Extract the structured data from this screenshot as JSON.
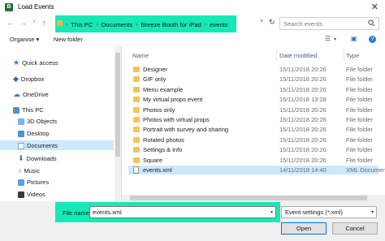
{
  "window": {
    "title": "Load Events",
    "app_icon_letter": "B"
  },
  "nav": {
    "back": "←",
    "forward": "→",
    "up": "↑",
    "dropdown": "˅",
    "refresh": "↻"
  },
  "address": {
    "crumbs": [
      "This PC",
      "Documents",
      "Breeze Booth for iPad",
      "events"
    ],
    "separator": "›",
    "leading_separator": "›"
  },
  "search": {
    "placeholder": "Search events",
    "icon": "search-icon"
  },
  "toolbar": {
    "organise": "Organise ▾",
    "new_folder": "New folder",
    "view_icon": "view-options-icon",
    "view_chev": "▾",
    "pane_icon": "preview-pane-icon",
    "help_icon": "help-icon"
  },
  "sidebar": {
    "items": [
      {
        "label": "Quick access",
        "icon": "star-icon",
        "color": "#2f7dd1"
      },
      {
        "label": "Dropbox",
        "icon": "dropbox-icon",
        "color": "#2468c8"
      },
      {
        "label": "OneDrive",
        "icon": "cloud-icon",
        "color": "#2f7dd1"
      },
      {
        "label": "This PC",
        "icon": "computer-icon",
        "color": "#5a8fc7"
      },
      {
        "label": "3D Objects",
        "icon": "cube-icon",
        "color": "#7fb2e5"
      },
      {
        "label": "Desktop",
        "icon": "desktop-icon",
        "color": "#4a90d9"
      },
      {
        "label": "Documents",
        "icon": "documents-icon",
        "color": "#c7ddf2"
      },
      {
        "label": "Downloads",
        "icon": "download-icon",
        "color": "#2f7dd1"
      },
      {
        "label": "Music",
        "icon": "music-icon",
        "color": "#3a87d4"
      },
      {
        "label": "Pictures",
        "icon": "pictures-icon",
        "color": "#5aa0dc"
      },
      {
        "label": "Videos",
        "icon": "video-icon",
        "color": "#3b3b3b"
      }
    ],
    "selected": "Documents"
  },
  "columns": {
    "name": "Name",
    "date": "Date modified",
    "type": "Type"
  },
  "files": [
    {
      "name": "Designer",
      "date": "15/11/2018 20:26",
      "type": "File folder",
      "kind": "folder"
    },
    {
      "name": "GIF only",
      "date": "15/11/2018 20:26",
      "type": "File folder",
      "kind": "folder"
    },
    {
      "name": "Menu example",
      "date": "15/11/2018 20:26",
      "type": "File folder",
      "kind": "folder"
    },
    {
      "name": "My virtual props event",
      "date": "16/11/2018 13:28",
      "type": "File folder",
      "kind": "folder"
    },
    {
      "name": "Photos only",
      "date": "15/11/2018 20:26",
      "type": "File folder",
      "kind": "folder"
    },
    {
      "name": "Photos with virtual props",
      "date": "15/11/2018 20:26",
      "type": "File folder",
      "kind": "folder"
    },
    {
      "name": "Portrait with survey and sharing",
      "date": "15/11/2018 20:26",
      "type": "File folder",
      "kind": "folder"
    },
    {
      "name": "Rotated photos",
      "date": "15/11/2018 20:26",
      "type": "File folder",
      "kind": "folder"
    },
    {
      "name": "Settings & info",
      "date": "15/11/2018 20:26",
      "type": "File folder",
      "kind": "folder"
    },
    {
      "name": "Square",
      "date": "15/11/2018 20:26",
      "type": "File folder",
      "kind": "folder"
    },
    {
      "name": "events.xml",
      "date": "14/11/2018 14:40",
      "type": "XML Documen",
      "kind": "xml"
    }
  ],
  "selected_file": "events.xml",
  "footer": {
    "file_name_label": "File name:",
    "file_name_value": "events.xml",
    "filter_value": "Event settings (*.xml)",
    "open_label": "Open",
    "cancel_label": "Cancel"
  },
  "colors": {
    "highlight": "#16e8b6",
    "selection": "#cce8ff",
    "folder": "#f2c45a"
  }
}
